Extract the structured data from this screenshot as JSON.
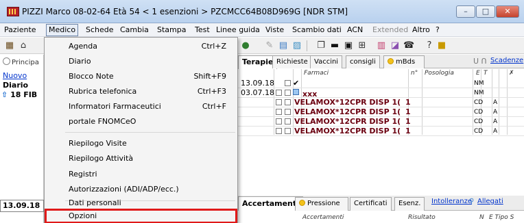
{
  "window": {
    "title": "PIZZI Marco 08-02-64 Età 54 < 1 esenzioni > PZCMCC64B08D969G [NDR STM]",
    "controls": {
      "minimize": "–",
      "maximize": "□",
      "close": "✕"
    }
  },
  "menubar": [
    {
      "label": "Paziente",
      "state": "normal"
    },
    {
      "label": "Medico",
      "state": "active"
    },
    {
      "label": "Schede",
      "state": "normal"
    },
    {
      "label": "Cambia",
      "state": "normal"
    },
    {
      "label": "Stampa",
      "state": "normal"
    },
    {
      "label": "Test",
      "state": "normal"
    },
    {
      "label": "Linee guida",
      "state": "normal"
    },
    {
      "label": "Viste",
      "state": "normal"
    },
    {
      "label": "Scambio dati",
      "state": "normal"
    },
    {
      "label": "ACN",
      "state": "normal"
    },
    {
      "label": "Extended",
      "state": "disabled"
    },
    {
      "label": "Altro",
      "state": "normal"
    },
    {
      "label": "?",
      "state": "normal"
    }
  ],
  "left_panel": {
    "radio": "Principa",
    "link": "Nuovo",
    "bold": "Diario",
    "date": "18 FIB",
    "date_box": "13.09.18"
  },
  "medico_menu": [
    {
      "label": "Agenda",
      "shortcut": "Ctrl+Z"
    },
    {
      "label": "Diario",
      "shortcut": ""
    },
    {
      "label": "Blocco Note",
      "shortcut": "Shift+F9"
    },
    {
      "label": "Rubrica telefonica",
      "shortcut": "Ctrl+F3"
    },
    {
      "label": "Informatori Farmaceutici",
      "shortcut": "Ctrl+F"
    },
    {
      "label": "portale FNOMCeO",
      "shortcut": ""
    },
    {
      "label": "Riepilogo Visite",
      "shortcut": ""
    },
    {
      "label": "Riepilogo Attività",
      "shortcut": ""
    },
    {
      "label": "Registri",
      "shortcut": ""
    },
    {
      "label": "Autorizzazioni (ADI/ADP/ecc.)",
      "shortcut": ""
    },
    {
      "label": "Dati personali",
      "shortcut": ""
    },
    {
      "label": "Opzioni",
      "shortcut": ""
    }
  ],
  "top_tabs": {
    "tabs": [
      "Terapie",
      "Richieste",
      "Vaccini",
      "consigli",
      "mBds"
    ],
    "active": "Terapie",
    "icons": "ᑌ ᑎ",
    "link": "Scadenze"
  },
  "therapy_grid": {
    "headers": {
      "farmaci": "Farmaci",
      "n": "n°",
      "posologia": "Posologia",
      "e": "E",
      "t": "T"
    },
    "rows": [
      {
        "date": "13.09.18",
        "drug": "",
        "n": "",
        "code": "NM",
        "flag": ""
      },
      {
        "date": "03.07.18",
        "drug": "xxx",
        "n": "",
        "code": "NM",
        "flag": ""
      },
      {
        "date": "",
        "drug": "VELAMOX*12CPR DISP 1(",
        "n": "1",
        "code": "CD",
        "flag": "A"
      },
      {
        "date": "",
        "drug": "VELAMOX*12CPR DISP 1(",
        "n": "1",
        "code": "CD",
        "flag": "A"
      },
      {
        "date": "",
        "drug": "VELAMOX*12CPR DISP 1(",
        "n": "1",
        "code": "CD",
        "flag": "A"
      },
      {
        "date": "",
        "drug": "VELAMOX*12CPR DISP 1(",
        "n": "1",
        "code": "CD",
        "flag": "A"
      }
    ]
  },
  "bottom_tabs": {
    "tabs": [
      "Accertamenti",
      "Pressione",
      "Certificati",
      "Esenz."
    ],
    "active": "Accertamenti",
    "links": [
      "Intolleranze",
      "Allegati"
    ]
  },
  "bottom_grid": {
    "headers": {
      "accertamenti": "Accertamenti",
      "risultato": "Risultato",
      "n": "N",
      "tipo": "E Tipo S"
    }
  },
  "colors": {
    "highlight_outline": "#e01a1a",
    "drug_text": "#6b0010",
    "link": "#0033cc"
  }
}
